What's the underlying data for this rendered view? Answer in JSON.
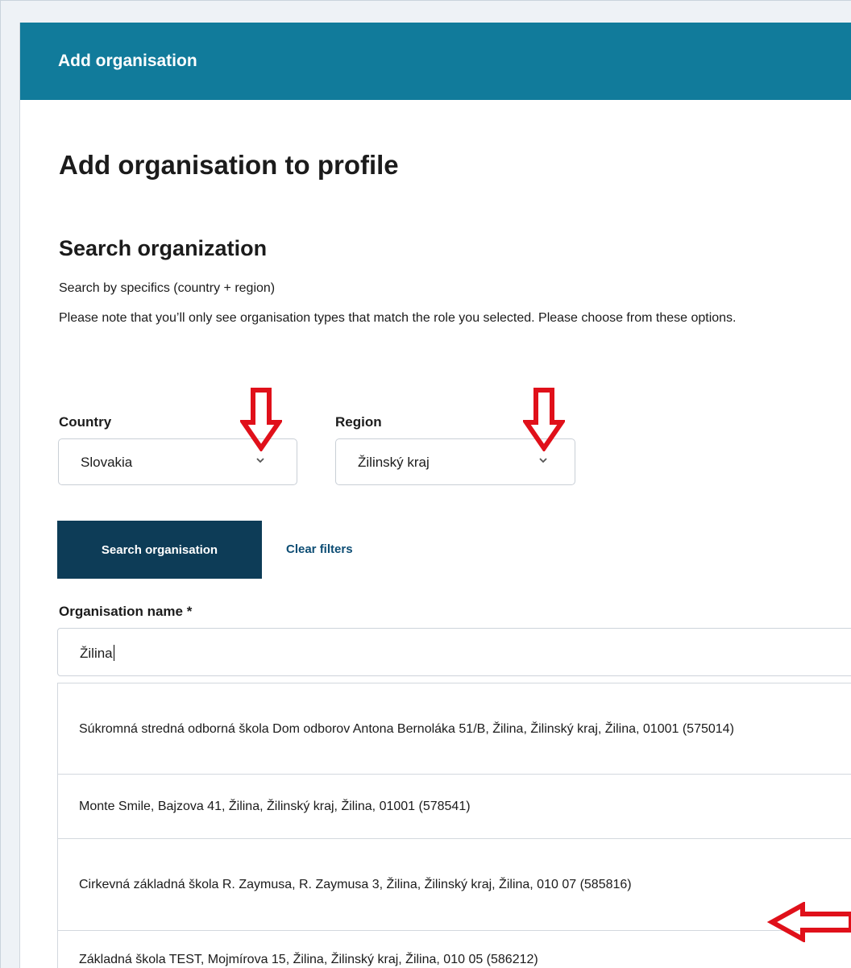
{
  "dialog": {
    "header_title": "Add organisation",
    "page_title": "Add organisation to profile"
  },
  "search": {
    "section_title": "Search organization",
    "help_line_1": "Search by specifics (country + region)",
    "help_line_2": "Please note that you’ll only see organisation types that match the role you selected. Please choose from these options.",
    "country": {
      "label": "Country",
      "value": "Slovakia"
    },
    "region": {
      "label": "Region",
      "value": "Žilinský kraj"
    },
    "search_button_label": "Search organisation",
    "clear_filters_label": "Clear filters"
  },
  "organisation": {
    "label": "Organisation name *",
    "input_value": "Žilina",
    "results": [
      "Súkromná stredná odborná škola Dom odborov Antona Bernoláka 51/B, Žilina, Žilinský kraj, Žilina, 01001 (575014)",
      "Monte Smile, Bajzova 41, Žilina, Žilinský kraj, Žilina, 01001 (578541)",
      "Cirkevná základná škola R. Zaymusa, R. Zaymusa 3, Žilina, Žilinský kraj, Žilina, 010 07 (585816)",
      "Základná škola TEST, Mojmírova 15, Žilina, Žilinský kraj, Žilina, 010 05 (586212)"
    ]
  },
  "colors": {
    "header_bg": "#117b9b",
    "primary_button": "#0d3c57",
    "annotation_arrow": "#e0101a"
  },
  "icons": {
    "select_chevron": "chevron-down-icon",
    "annotation_down": "arrow-down-icon",
    "annotation_left": "arrow-left-icon"
  }
}
